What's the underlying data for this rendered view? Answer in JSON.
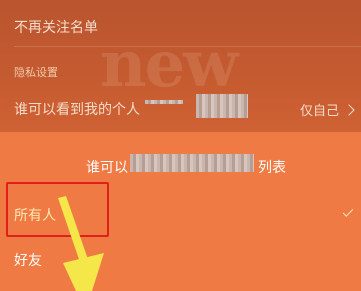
{
  "background_page": {
    "rows": {
      "unfollow_list": "不再关注名单",
      "privacy_section": "隐私设置",
      "who_can_see": "谁可以看到我的个人",
      "who_can_see_value": "仅自己"
    },
    "watermark_text": "new"
  },
  "sheet": {
    "title_left": "谁可以",
    "title_right": "列表",
    "options": [
      {
        "label": "所有人",
        "selected": true
      },
      {
        "label": "好友",
        "selected": false
      }
    ]
  },
  "colors": {
    "sheet_bg": "#ef7a44",
    "dimmed_bg": "#c45a30",
    "selected_text": "#ffe7b3",
    "highlight_box": "#e1201b",
    "arrow": "#f5e64a"
  },
  "icons": {
    "check": "check-icon",
    "chevron": "chevron-right-icon"
  }
}
